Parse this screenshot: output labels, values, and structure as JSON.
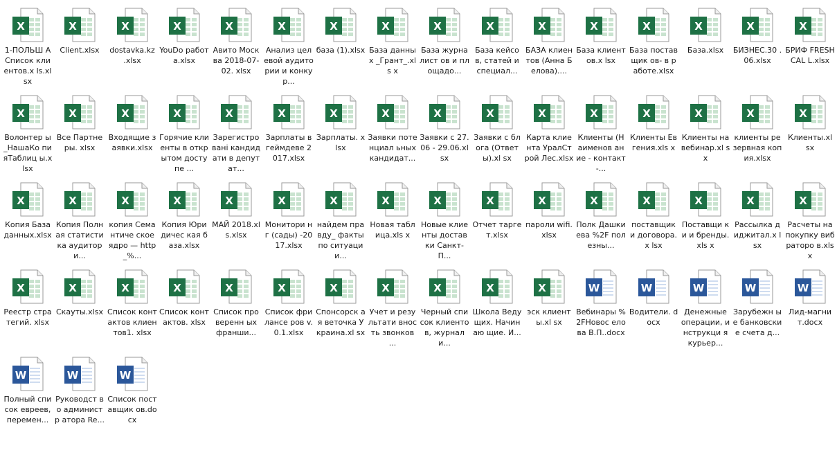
{
  "files": [
    {
      "label": "1-ПОЛЬШ А Список клиентов.x ls.xlsx",
      "type": "xlsx"
    },
    {
      "label": "Client.xlsx",
      "type": "xlsx"
    },
    {
      "label": "dostavka.kz .xlsx",
      "type": "xlsx"
    },
    {
      "label": "YouDo работа.xlsx",
      "type": "xlsx"
    },
    {
      "label": "Авито Москва 2018-07-02. xlsx",
      "type": "xlsx"
    },
    {
      "label": "Анализ целевой аудитории и конкур...",
      "type": "xlsx"
    },
    {
      "label": "база (1).xlsx",
      "type": "xlsx"
    },
    {
      "label": "База данных _Грант_.xls x",
      "type": "xlsx"
    },
    {
      "label": "База журналист ов и площадо...",
      "type": "xlsx"
    },
    {
      "label": "База кейсов, статей и специал...",
      "type": "xlsx"
    },
    {
      "label": "БАЗА клиентов (Анна Белова)....",
      "type": "xlsx"
    },
    {
      "label": "База клиентов.x lsx",
      "type": "xlsx"
    },
    {
      "label": "База поставщик ов- в работе.xlsx",
      "type": "xlsx"
    },
    {
      "label": "База.xlsx",
      "type": "xlsx"
    },
    {
      "label": "БИЗНЕС.30 .06.xlsx",
      "type": "xlsx"
    },
    {
      "label": "БРИФ FRESHCAL L.xlsx",
      "type": "xlsx"
    },
    {
      "label": "Волонтер ы_НашаКо пияТаблиц ы.xlsx",
      "type": "xlsx"
    },
    {
      "label": "Все Партнеры. xlsx",
      "type": "xlsx"
    },
    {
      "label": "Входящие заявки.xlsx",
      "type": "xlsx"
    },
    {
      "label": "Горячие клиенты в открытом доступе ...",
      "type": "xlsx"
    },
    {
      "label": "Зарегистро вані кандидати в депутат...",
      "type": "xlsx"
    },
    {
      "label": "Зарплаты в геймдеве 2017.xlsx",
      "type": "xlsx"
    },
    {
      "label": "Зарплаты. xlsx",
      "type": "xlsx"
    },
    {
      "label": "Заявки потенциал ьных кандидат...",
      "type": "xlsx"
    },
    {
      "label": "Заявки с 27.06 - 29.06.xlsx",
      "type": "xlsx"
    },
    {
      "label": "Заявки с блога (Ответы).xl sx",
      "type": "xlsx"
    },
    {
      "label": "Карта клиента УралСтрой Лес.xlsx",
      "type": "xlsx"
    },
    {
      "label": "Клиенты (Наименов ание - контакт -...",
      "type": "xlsx"
    },
    {
      "label": "Клиенты Евгения.xls x",
      "type": "xlsx"
    },
    {
      "label": "Клиенты на вебинар.xl sx",
      "type": "xlsx"
    },
    {
      "label": "клиенты резервная копия.xlsx",
      "type": "xlsx"
    },
    {
      "label": "Клиенты.xl sx",
      "type": "xlsx"
    },
    {
      "label": "Копия База данных.xlsx",
      "type": "xlsx"
    },
    {
      "label": "Копия Полная статистика аудитори...",
      "type": "xlsx"
    },
    {
      "label": "копия Семантиче ское ядро — http_%...",
      "type": "xlsx"
    },
    {
      "label": "Копия Юридичес кая база.xlsx",
      "type": "xlsx"
    },
    {
      "label": "МАЙ 2018.xls.xlsx",
      "type": "xlsx"
    },
    {
      "label": "Монитори нг (сады) -2017.xlsx",
      "type": "xlsx"
    },
    {
      "label": "найдем правду_ факты по ситуации...",
      "type": "xlsx"
    },
    {
      "label": "Новая таблица.xls x",
      "type": "xlsx"
    },
    {
      "label": "Новые клиенты доставки Санкт-П...",
      "type": "xlsx"
    },
    {
      "label": "Отчет таргет.xlsx",
      "type": "xlsx"
    },
    {
      "label": "пароли wifi.xlsx",
      "type": "xlsx"
    },
    {
      "label": "Полк Дашкиева %2F полезны...",
      "type": "xlsx"
    },
    {
      "label": "поставщик и договора.x lsx",
      "type": "xlsx"
    },
    {
      "label": "Поставщи ки и бренды.xls x",
      "type": "xlsx"
    },
    {
      "label": "Рассылка диджитал.x lsx",
      "type": "xlsx"
    },
    {
      "label": "Расчеты на покупку вибраторо в.xlsx",
      "type": "xlsx"
    },
    {
      "label": "Реестр стратегий. xlsx",
      "type": "xlsx"
    },
    {
      "label": "Скауты.xlsx",
      "type": "xlsx"
    },
    {
      "label": "Список контактов клиентов1. xlsx",
      "type": "xlsx"
    },
    {
      "label": "Список контактов. xlsx",
      "type": "xlsx"
    },
    {
      "label": "Список проверенн ых франши...",
      "type": "xlsx"
    },
    {
      "label": "Список фрилансе ров v.0.1.xlsx",
      "type": "xlsx"
    },
    {
      "label": "Спонсорск ая веточка Украина.xl sx",
      "type": "xlsx"
    },
    {
      "label": "Учет и результати вность звонков ...",
      "type": "xlsx"
    },
    {
      "label": "Черный список клиентов, журнали...",
      "type": "xlsx"
    },
    {
      "label": "Школа Ведущих. Начинаю щие. И...",
      "type": "xlsx"
    },
    {
      "label": "эск клиенты.xl sx",
      "type": "xlsx"
    },
    {
      "label": "Вебинары %2FНовос елова В.П..docx",
      "type": "docx"
    },
    {
      "label": "Водители. docx",
      "type": "docx"
    },
    {
      "label": "Денежные операции, инструкци я курьер...",
      "type": "docx"
    },
    {
      "label": "Зарубежн ые банковски е счета д...",
      "type": "docx"
    },
    {
      "label": "Лид-магни т.docx",
      "type": "docx"
    },
    {
      "label": "Полный список евреев, перемен...",
      "type": "docx"
    },
    {
      "label": "Руководст во администр атора Re...",
      "type": "docx"
    },
    {
      "label": "Список поставщик ов.docx",
      "type": "docx"
    }
  ],
  "colors": {
    "excel_green": "#1e7145",
    "excel_light": "#c9e3cf",
    "word_blue": "#2b579a",
    "word_light": "#cfdcf0"
  },
  "icons": {
    "xlsx": "excel-file-icon",
    "docx": "word-file-icon"
  }
}
